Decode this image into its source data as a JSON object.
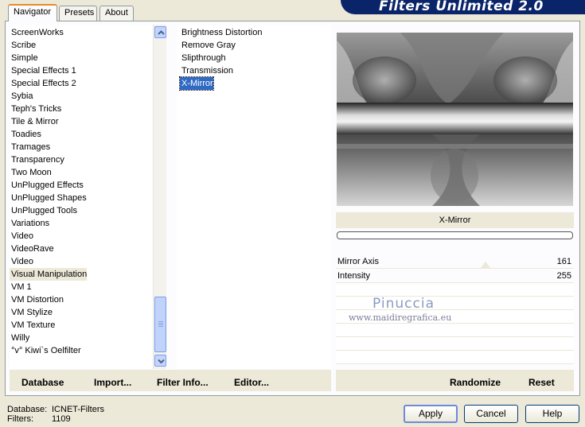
{
  "banner": {
    "title": "Filters Unlimited 2.0"
  },
  "tabs": [
    {
      "label": "Navigator"
    },
    {
      "label": "Presets"
    },
    {
      "label": "About"
    }
  ],
  "categories": [
    "ScreenWorks",
    "Scribe",
    "Simple",
    "Special Effects 1",
    "Special Effects 2",
    "Sybia",
    "Teph's Tricks",
    "Tile & Mirror",
    "Toadies",
    "Tramages",
    "Transparency",
    "Two Moon",
    "UnPlugged Effects",
    "UnPlugged Shapes",
    "UnPlugged Tools",
    "Variations",
    "Video",
    "VideoRave",
    "Video",
    "Visual Manipulation",
    "VM 1",
    "VM Distortion",
    "VM Stylize",
    "VM Texture",
    "Willy",
    "°v° Kiwi`s Oelfilter"
  ],
  "selected_category": "Visual Manipulation",
  "filters": [
    "Brightness Distortion",
    "Remove Gray",
    "Slipthrough",
    "Transmission",
    "X-Mirror"
  ],
  "selected_filter": "X-Mirror",
  "filter_title": "X-Mirror",
  "params": [
    {
      "label": "Mirror Axis",
      "value": "161"
    },
    {
      "label": "Intensity",
      "value": "255"
    }
  ],
  "watermark": {
    "name": "Pinuccia",
    "site": "www.maidiregrafica.eu"
  },
  "left_buttons": {
    "database": "Database",
    "import": "Import...",
    "filter_info": "Filter Info...",
    "editor": "Editor..."
  },
  "right_buttons": {
    "randomize": "Randomize",
    "reset": "Reset"
  },
  "footer": {
    "database_label": "Database:",
    "database_value": "ICNET-Filters",
    "filters_label": "Filters:",
    "filters_value": "1109"
  },
  "dialog_buttons": {
    "apply": "Apply",
    "cancel": "Cancel",
    "help": "Help"
  },
  "colors": {
    "banner": "#0a246a",
    "selection": "#316ac5",
    "dialog_bg": "#ece9d8",
    "tab_accent": "#e68b2c"
  }
}
